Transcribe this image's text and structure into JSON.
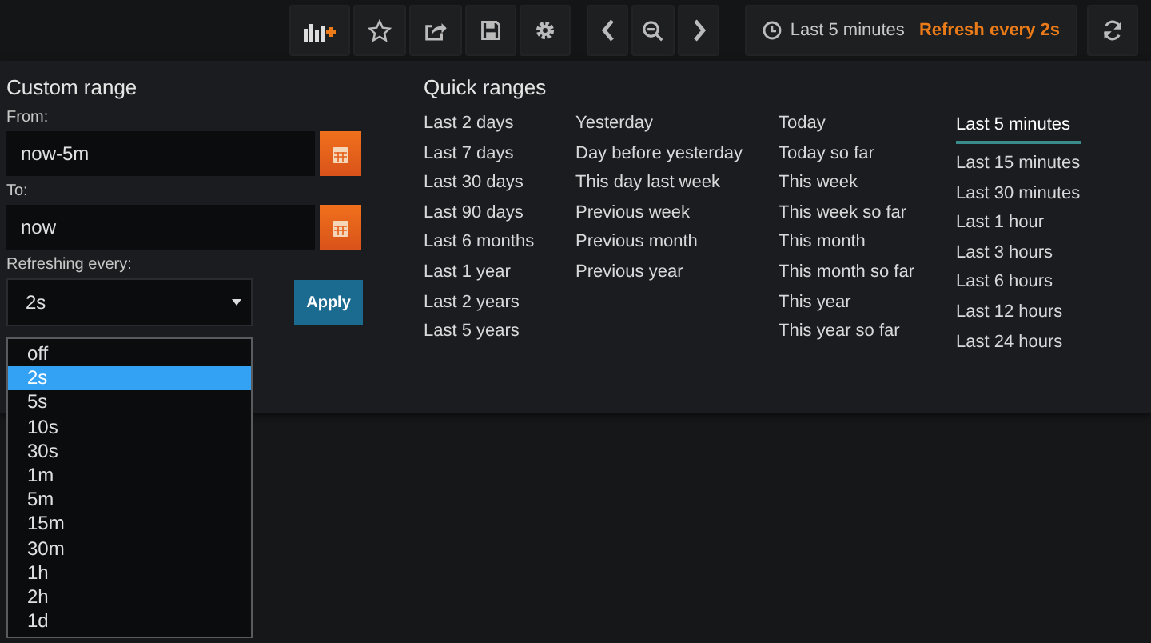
{
  "toolbar": {
    "buttons": [
      {
        "kind": "add-panel"
      },
      {
        "kind": "star"
      },
      {
        "kind": "share"
      },
      {
        "kind": "save"
      },
      {
        "kind": "settings"
      }
    ],
    "nav": [
      {
        "kind": "back"
      },
      {
        "kind": "zoom-out"
      },
      {
        "kind": "forward"
      }
    ],
    "time_picker": {
      "label": "Last 5 minutes",
      "refresh": "Refresh every 2s"
    }
  },
  "custom_range": {
    "title": "Custom range",
    "from_label": "From:",
    "from": "now-5m",
    "to_label": "To:",
    "to": "now",
    "refresh_label": "Refreshing every:",
    "refresh_value": "2s",
    "apply": "Apply"
  },
  "refresh_options": [
    {
      "label": "off",
      "selected": false
    },
    {
      "label": "2s",
      "selected": true
    },
    {
      "label": "5s",
      "selected": false
    },
    {
      "label": "10s",
      "selected": false
    },
    {
      "label": "30s",
      "selected": false
    },
    {
      "label": "1m",
      "selected": false
    },
    {
      "label": "5m",
      "selected": false
    },
    {
      "label": "15m",
      "selected": false
    },
    {
      "label": "30m",
      "selected": false
    },
    {
      "label": "1h",
      "selected": false
    },
    {
      "label": "2h",
      "selected": false
    },
    {
      "label": "1d",
      "selected": false
    }
  ],
  "quick_ranges": {
    "title": "Quick ranges",
    "columns": [
      [
        {
          "label": "Last 2 days",
          "selected": false
        },
        {
          "label": "Last 7 days",
          "selected": false
        },
        {
          "label": "Last 30 days",
          "selected": false
        },
        {
          "label": "Last 90 days",
          "selected": false
        },
        {
          "label": "Last 6 months",
          "selected": false
        },
        {
          "label": "Last 1 year",
          "selected": false
        },
        {
          "label": "Last 2 years",
          "selected": false
        },
        {
          "label": "Last 5 years",
          "selected": false
        }
      ],
      [
        {
          "label": "Yesterday",
          "selected": false
        },
        {
          "label": "Day before yesterday",
          "selected": false
        },
        {
          "label": "This day last week",
          "selected": false
        },
        {
          "label": "Previous week",
          "selected": false
        },
        {
          "label": "Previous month",
          "selected": false
        },
        {
          "label": "Previous year",
          "selected": false
        }
      ],
      [
        {
          "label": "Today",
          "selected": false
        },
        {
          "label": "Today so far",
          "selected": false
        },
        {
          "label": "This week",
          "selected": false
        },
        {
          "label": "This week so far",
          "selected": false
        },
        {
          "label": "This month",
          "selected": false
        },
        {
          "label": "This month so far",
          "selected": false
        },
        {
          "label": "This year",
          "selected": false
        },
        {
          "label": "This year so far",
          "selected": false
        }
      ],
      [
        {
          "label": "Last 5 minutes",
          "selected": true
        },
        {
          "label": "Last 15 minutes",
          "selected": false
        },
        {
          "label": "Last 30 minutes",
          "selected": false
        },
        {
          "label": "Last 1 hour",
          "selected": false
        },
        {
          "label": "Last 3 hours",
          "selected": false
        },
        {
          "label": "Last 6 hours",
          "selected": false
        },
        {
          "label": "Last 12 hours",
          "selected": false
        },
        {
          "label": "Last 24 hours",
          "selected": false
        }
      ]
    ]
  }
}
